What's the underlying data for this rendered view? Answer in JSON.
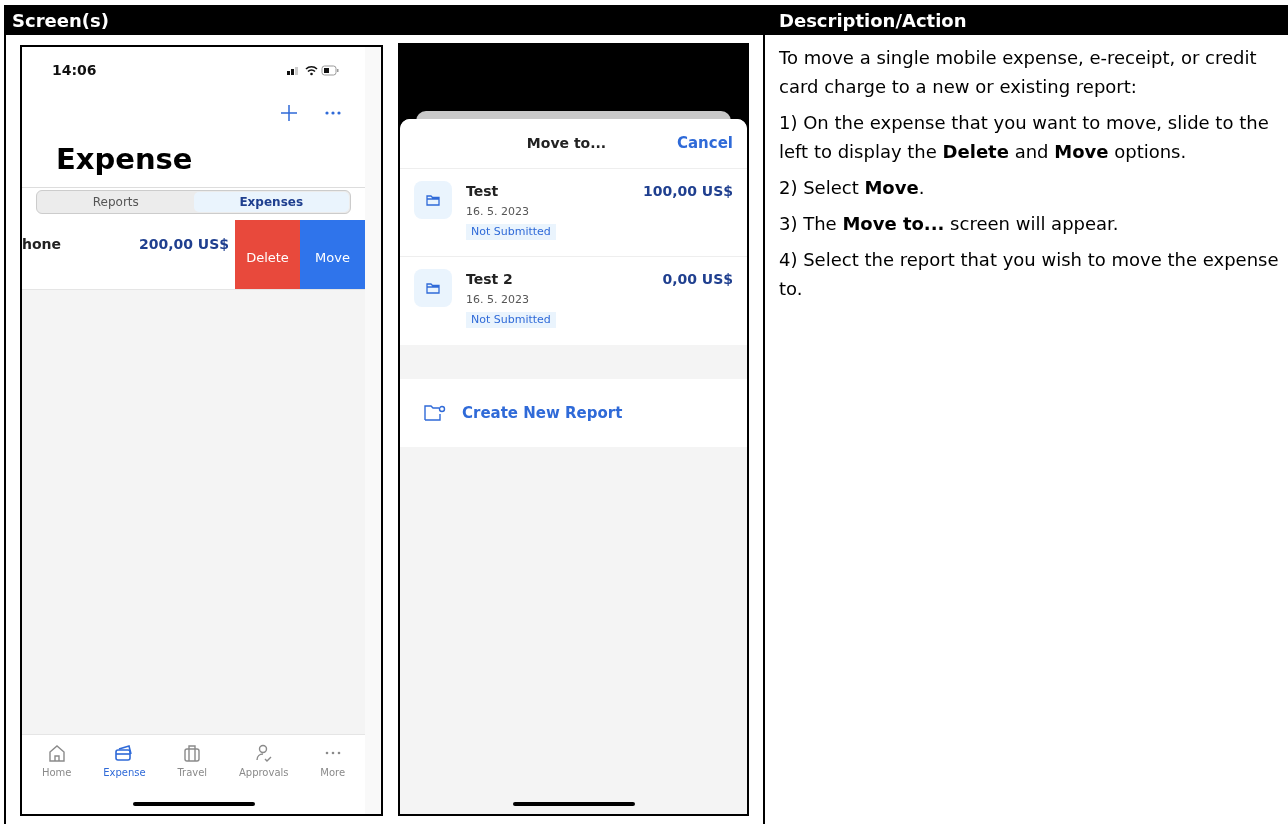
{
  "table": {
    "columns": [
      "Screen(s)",
      "Description/Action"
    ]
  },
  "expense_screen": {
    "status_time": "14:06",
    "title": "Expense",
    "segments": [
      {
        "label": "Reports",
        "selected": false
      },
      {
        "label": "Expenses",
        "selected": true
      }
    ],
    "expense_row": {
      "name": "hone",
      "amount": "200,00 US$"
    },
    "swipe_actions": [
      {
        "label": "Delete",
        "kind": "destructive"
      },
      {
        "label": "Move",
        "kind": "primary"
      }
    ],
    "tab_bar": [
      {
        "label": "Home",
        "selected": false
      },
      {
        "label": "Expense",
        "selected": true
      },
      {
        "label": "Travel",
        "selected": false
      },
      {
        "label": "Approvals",
        "selected": false
      },
      {
        "label": "More",
        "selected": false
      }
    ]
  },
  "move_screen": {
    "title": "Move to...",
    "cancel": "Cancel",
    "reports": [
      {
        "name": "Test",
        "date": "16. 5. 2023",
        "status": "Not Submitted",
        "amount": "100,00 US$"
      },
      {
        "name": "Test 2",
        "date": "16. 5. 2023",
        "status": "Not Submitted",
        "amount": "0,00 US$"
      }
    ],
    "create_label": "Create New Report"
  },
  "description": [
    "To move a single mobile expense, e-receipt, or credit card charge to a new or existing report:",
    "1) On the expense that you want to move, slide to the left to display the **Delete** and **Move** options.",
    "2) Select **Move**.",
    "3) The **Move to...** screen will appear.",
    "4) Select the report that you wish to move the expense to."
  ]
}
